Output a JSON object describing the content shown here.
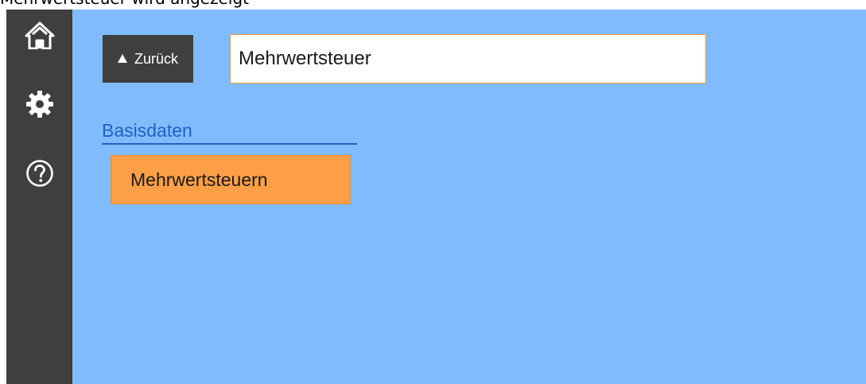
{
  "top_banner": {
    "text": "Mehrwertsteuer wird angezeigt"
  },
  "sidebar": {
    "items": [
      {
        "name": "home",
        "icon": "home-icon",
        "active": true
      },
      {
        "name": "settings",
        "icon": "gear-icon",
        "active": false
      },
      {
        "name": "help",
        "icon": "help-circle-icon",
        "active": false
      }
    ]
  },
  "toolbar": {
    "back_label": "Zurück",
    "search_value": "Mehrwertsteuer"
  },
  "results": {
    "section_title": "Basisdaten",
    "items": [
      {
        "label": "Mehrwertsteuern"
      }
    ]
  },
  "colors": {
    "sidebar": "#3f3f3f",
    "background": "#80bcfd",
    "accent": "#fd9f47",
    "input_border": "#f39a2c",
    "section_header": "#1e60c8"
  }
}
